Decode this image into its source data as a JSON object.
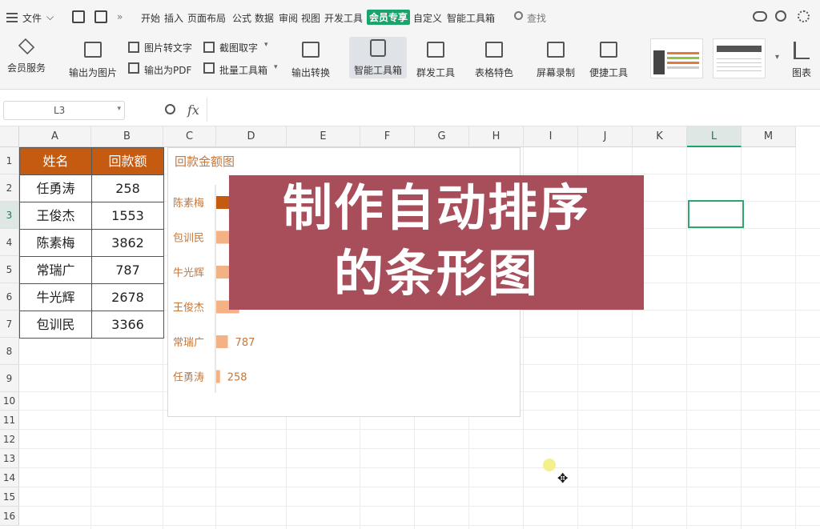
{
  "menu": {
    "file": "文件",
    "tabs": [
      "开始",
      "插入",
      "页面布局",
      "公式",
      "数据",
      "审阅",
      "视图",
      "开发工具",
      "会员专享",
      "自定义",
      "智能工具箱"
    ],
    "active_tab": "会员专享",
    "search": "查找"
  },
  "ribbon": {
    "member_service": "会员服务",
    "export_image": "输出为图片",
    "image_to_text": "图片转文字",
    "export_pdf": "输出为PDF",
    "screenshot_text": "截图取字",
    "batch_tools": "批量工具箱",
    "export_convert": "输出转换",
    "smart_toolbox": "智能工具箱",
    "mass_tools": "群发工具",
    "table_features": "表格特色",
    "screen_record": "屏幕录制",
    "quick_tools": "便捷工具",
    "chart": "图表"
  },
  "formula_bar": {
    "cell_ref": "L3",
    "fx": "fx",
    "value": ""
  },
  "columns": [
    "A",
    "B",
    "C",
    "D",
    "E",
    "F",
    "G",
    "H",
    "I",
    "J",
    "K",
    "L",
    "M"
  ],
  "active_column": "L",
  "rows": [
    "1",
    "2",
    "3",
    "4",
    "5",
    "6",
    "7",
    "8",
    "9",
    "10",
    "11",
    "12",
    "13",
    "14",
    "15",
    "16"
  ],
  "active_row": "3",
  "table": {
    "headers": [
      "姓名",
      "回款额"
    ],
    "rows": [
      [
        "任勇涛",
        "258"
      ],
      [
        "王俊杰",
        "1553"
      ],
      [
        "陈素梅",
        "3862"
      ],
      [
        "常瑞广",
        "787"
      ],
      [
        "牛光辉",
        "2678"
      ],
      [
        "包训民",
        "3366"
      ]
    ]
  },
  "chart_data": {
    "type": "bar",
    "orientation": "horizontal",
    "title": "回款金额图",
    "categories": [
      "陈素梅",
      "包训民",
      "牛光辉",
      "王俊杰",
      "常瑞广",
      "任勇涛"
    ],
    "values": [
      3862,
      3366,
      2678,
      1553,
      787,
      258
    ],
    "visible_data_labels": [
      "787",
      "258"
    ],
    "colors": {
      "bar": "#f4b183",
      "highlight": "#c55a11",
      "label": "#c5763a"
    }
  },
  "overlay": {
    "line1": "制作自动排序",
    "line2": "的条形图"
  },
  "colors": {
    "accent": "#1aa36a",
    "header_fill": "#c55a11",
    "overlay": "#a84e5a"
  }
}
